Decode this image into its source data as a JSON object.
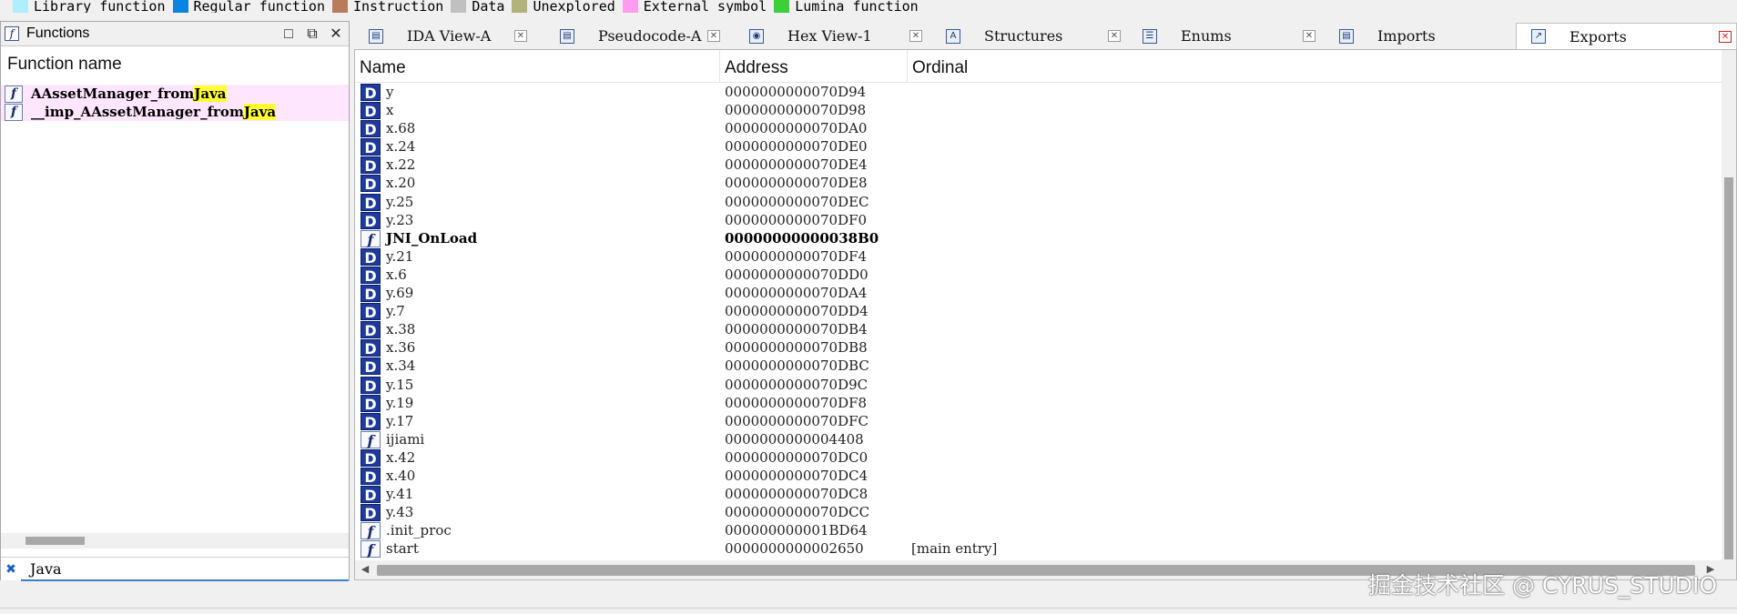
{
  "legend": [
    {
      "label": "Library function",
      "color": "#aeeeff"
    },
    {
      "label": "Regular function",
      "color": "#0a84e0"
    },
    {
      "label": "Instruction",
      "color": "#b87c5c"
    },
    {
      "label": "Data",
      "color": "#c0c0c0"
    },
    {
      "label": "Unexplored",
      "color": "#b0b47a"
    },
    {
      "label": "External symbol",
      "color": "#ff9cf0"
    },
    {
      "label": "Lumina function",
      "color": "#3ccf3c"
    }
  ],
  "functions_panel": {
    "title": "Functions",
    "column_header": "Function name",
    "items": [
      {
        "prefix": "AAssetManager_from",
        "match": "Java"
      },
      {
        "prefix": "__imp_AAssetManager_from",
        "match": "Java"
      }
    ],
    "filter_value": "Java"
  },
  "tabs": [
    {
      "label": "IDA View-A",
      "icon": "ida-view-icon"
    },
    {
      "label": "Pseudocode-A",
      "icon": "pseudocode-icon"
    },
    {
      "label": "Hex View-1",
      "icon": "hex-view-icon"
    },
    {
      "label": "Structures",
      "icon": "structures-icon"
    },
    {
      "label": "Enums",
      "icon": "enums-icon"
    },
    {
      "label": "Imports",
      "icon": "imports-icon"
    },
    {
      "label": "Exports",
      "icon": "exports-icon",
      "active": true
    }
  ],
  "exports": {
    "columns": [
      "Name",
      "Address",
      "Ordinal"
    ],
    "rows": [
      {
        "type": "D",
        "name": "y",
        "address": "0000000000070D94",
        "ordinal": ""
      },
      {
        "type": "D",
        "name": "x",
        "address": "0000000000070D98",
        "ordinal": ""
      },
      {
        "type": "D",
        "name": "x.68",
        "address": "0000000000070DA0",
        "ordinal": ""
      },
      {
        "type": "D",
        "name": "x.24",
        "address": "0000000000070DE0",
        "ordinal": ""
      },
      {
        "type": "D",
        "name": "x.22",
        "address": "0000000000070DE4",
        "ordinal": ""
      },
      {
        "type": "D",
        "name": "x.20",
        "address": "0000000000070DE8",
        "ordinal": ""
      },
      {
        "type": "D",
        "name": "y.25",
        "address": "0000000000070DEC",
        "ordinal": ""
      },
      {
        "type": "D",
        "name": "y.23",
        "address": "0000000000070DF0",
        "ordinal": ""
      },
      {
        "type": "f",
        "name": "JNI_OnLoad",
        "address": "00000000000038B0",
        "ordinal": "",
        "bold": true
      },
      {
        "type": "D",
        "name": "y.21",
        "address": "0000000000070DF4",
        "ordinal": ""
      },
      {
        "type": "D",
        "name": "x.6",
        "address": "0000000000070DD0",
        "ordinal": ""
      },
      {
        "type": "D",
        "name": "y.69",
        "address": "0000000000070DA4",
        "ordinal": ""
      },
      {
        "type": "D",
        "name": "y.7",
        "address": "0000000000070DD4",
        "ordinal": ""
      },
      {
        "type": "D",
        "name": "x.38",
        "address": "0000000000070DB4",
        "ordinal": ""
      },
      {
        "type": "D",
        "name": "x.36",
        "address": "0000000000070DB8",
        "ordinal": ""
      },
      {
        "type": "D",
        "name": "x.34",
        "address": "0000000000070DBC",
        "ordinal": ""
      },
      {
        "type": "D",
        "name": "y.15",
        "address": "0000000000070D9C",
        "ordinal": ""
      },
      {
        "type": "D",
        "name": "y.19",
        "address": "0000000000070DF8",
        "ordinal": ""
      },
      {
        "type": "D",
        "name": "y.17",
        "address": "0000000000070DFC",
        "ordinal": ""
      },
      {
        "type": "f",
        "name": "ijiami",
        "address": "0000000000004408",
        "ordinal": ""
      },
      {
        "type": "D",
        "name": "x.42",
        "address": "0000000000070DC0",
        "ordinal": ""
      },
      {
        "type": "D",
        "name": "x.40",
        "address": "0000000000070DC4",
        "ordinal": ""
      },
      {
        "type": "D",
        "name": "y.41",
        "address": "0000000000070DC8",
        "ordinal": ""
      },
      {
        "type": "D",
        "name": "y.43",
        "address": "0000000000070DCC",
        "ordinal": ""
      },
      {
        "type": "f",
        "name": ".init_proc",
        "address": "000000000001BD64",
        "ordinal": ""
      },
      {
        "type": "f",
        "name": "start",
        "address": "0000000000002650",
        "ordinal": "[main entry]"
      }
    ]
  },
  "watermark": "掘金技术社区 @ CYRUS_STUDIO"
}
